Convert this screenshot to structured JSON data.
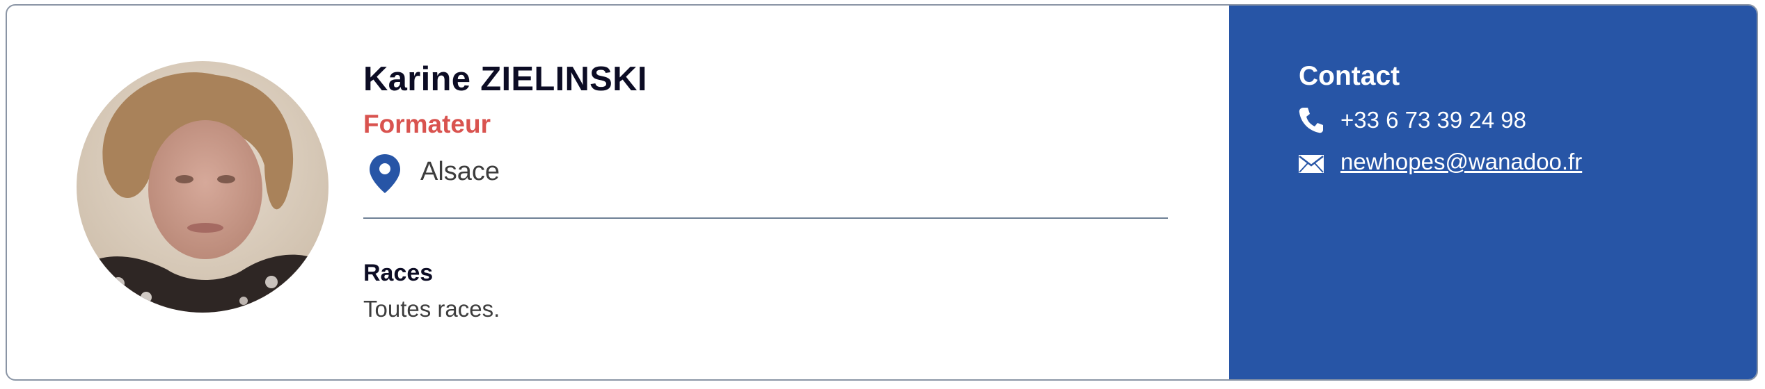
{
  "profile": {
    "name": "Karine ZIELINSKI",
    "role": "Formateur",
    "location": "Alsace",
    "role_color": "#d9534f"
  },
  "races": {
    "title": "Races",
    "text": "Toutes races."
  },
  "contact": {
    "title": "Contact",
    "phone": "+33 6 73 39 24 98",
    "email": "newhopes@wanadoo.fr",
    "panel_color": "#2755a6"
  },
  "icons": {
    "location": "location-pin-icon",
    "phone": "phone-icon",
    "email": "envelope-icon"
  }
}
